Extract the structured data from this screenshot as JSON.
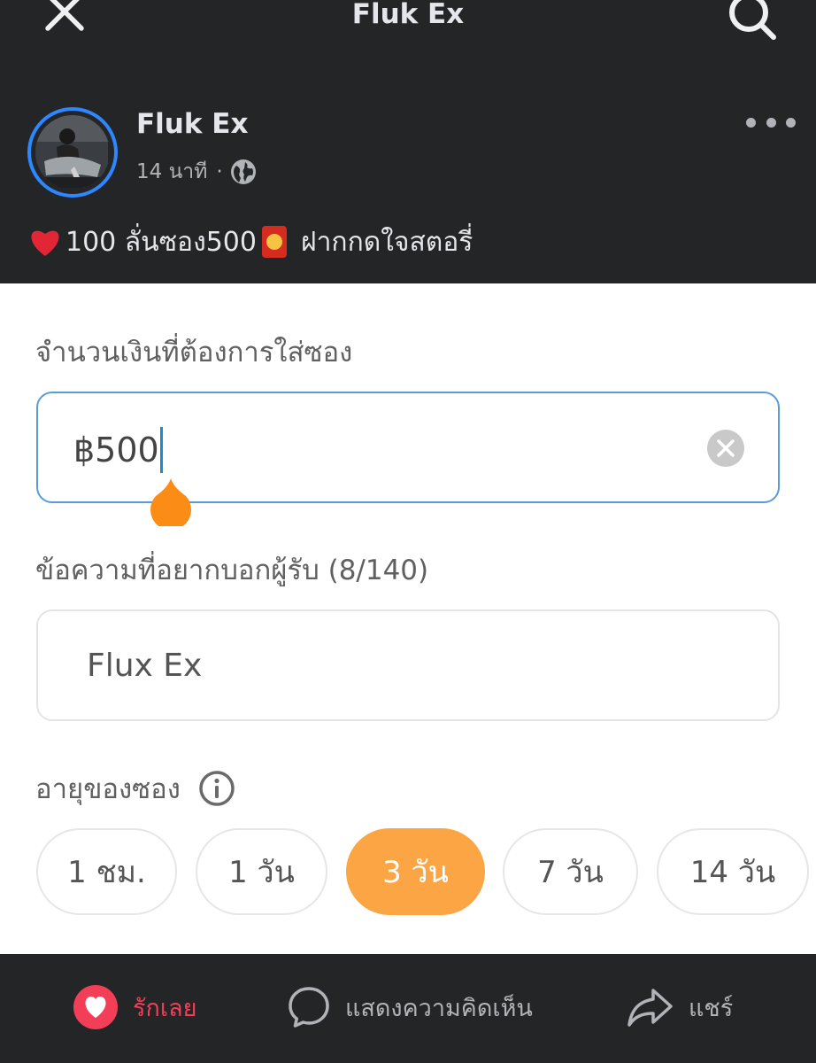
{
  "header": {
    "title": "Fluk Ex"
  },
  "post": {
    "author": "Fluk Ex",
    "time": "14 นาที",
    "separator": "·",
    "text": "100 ลั่นซอง500",
    "text_suffix": "ฝากกดใจสตอรี่"
  },
  "form": {
    "amount_label": "จำนวนเงินที่ต้องการใส่ซอง",
    "amount_value": "฿500",
    "message_label": "ข้อความที่อยากบอกผู้รับ (8/140)",
    "message_value": "Flux Ex",
    "age_label": "อายุของซอง",
    "durations": [
      "1 ชม.",
      "1 วัน",
      "3 วัน",
      "7 วัน",
      "14 วัน"
    ],
    "selected_duration": "3 วัน"
  },
  "actions": {
    "like": "รักเลย",
    "comment": "แสดงความคิดเห็น",
    "share": "แชร์"
  },
  "colors": {
    "dark_bg": "#242526",
    "accent_orange": "#fca544",
    "focus_blue": "#5b9bd5",
    "like_red": "#f33e58",
    "avatar_ring": "#2d88ff"
  },
  "icons": [
    "close-icon",
    "search-icon",
    "globe-icon",
    "more-icon",
    "heart-emoji",
    "red-envelope-emoji",
    "clear-icon",
    "info-icon",
    "like-icon",
    "comment-icon",
    "share-icon"
  ]
}
